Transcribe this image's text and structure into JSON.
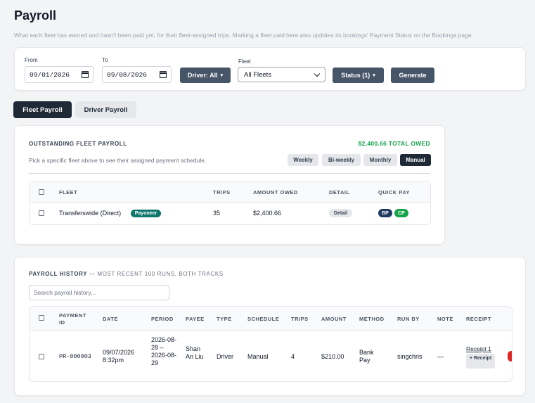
{
  "page": {
    "title": "Payroll",
    "subtitle": "What each fleet has earned and hasn't been paid yet, for their fleet-assigned trips. Marking a fleet paid here also updates its bookings' Payment Status on the Bookings page."
  },
  "filters": {
    "from_label": "From",
    "from_value": "09/01/2026",
    "to_label": "To",
    "to_value": "09/08/2026",
    "driver_button": "Driver: All",
    "fleet_label": "Fleet",
    "fleet_value": "All Fleets",
    "status_button": "Status (1)",
    "generate_button": "Generate"
  },
  "tabs": [
    {
      "label": "Fleet Payroll",
      "active": true
    },
    {
      "label": "Driver Payroll",
      "active": false
    }
  ],
  "outstanding": {
    "title": "OUTSTANDING FLEET PAYROLL",
    "total": "$2,400.66 TOTAL OWED",
    "hint": "Pick a specific fleet above to see their assigned payment schedule.",
    "schedules": [
      {
        "label": "Weekly",
        "active": false
      },
      {
        "label": "Bi-weekly",
        "active": false
      },
      {
        "label": "Monthly",
        "active": false
      },
      {
        "label": "Manual",
        "active": true
      }
    ],
    "columns": [
      "FLEET",
      "TRIPS",
      "AMOUNT OWED",
      "DETAIL",
      "QUICK PAY"
    ],
    "rows": [
      {
        "fleet": "Transferswide (Direct)",
        "badge": "Payoneer",
        "trips": "35",
        "amount": "$2,400.66",
        "detail": "Detail",
        "quick_pay": [
          "BP",
          "CP"
        ]
      }
    ]
  },
  "history": {
    "title": "PAYROLL HISTORY",
    "title_suffix": " — MOST RECENT 100 RUNS, BOTH TRACKS",
    "search_placeholder": "Search payroll history...",
    "columns": [
      "PAYMENT ID",
      "DATE",
      "PERIOD",
      "PAYEE",
      "TYPE",
      "SCHEDULE",
      "TRIPS",
      "AMOUNT",
      "METHOD",
      "RUN BY",
      "NOTE",
      "RECEIPT"
    ],
    "rows": [
      {
        "payment_id": "PR-000003",
        "date": "09/07/2026 8:32pm",
        "period": "2026-08-28 – 2026-08-29",
        "payee": "Shan An Liu",
        "type": "Driver",
        "schedule": "Manual",
        "trips": "4",
        "amount": "$210.00",
        "method": "Bank Pay",
        "run_by": "singchris",
        "note": "—",
        "receipt_link": "Receipt 1",
        "add_receipt": "+ Receipt"
      }
    ]
  },
  "colors": {
    "primary_dark": "#1f2937",
    "slate_button": "#475569",
    "green_total": "#16a34a",
    "payoneer_badge": "#0f766e",
    "bp_badge": "#1e3a5f",
    "cp_badge": "#16a34a",
    "danger": "#dc2626"
  }
}
